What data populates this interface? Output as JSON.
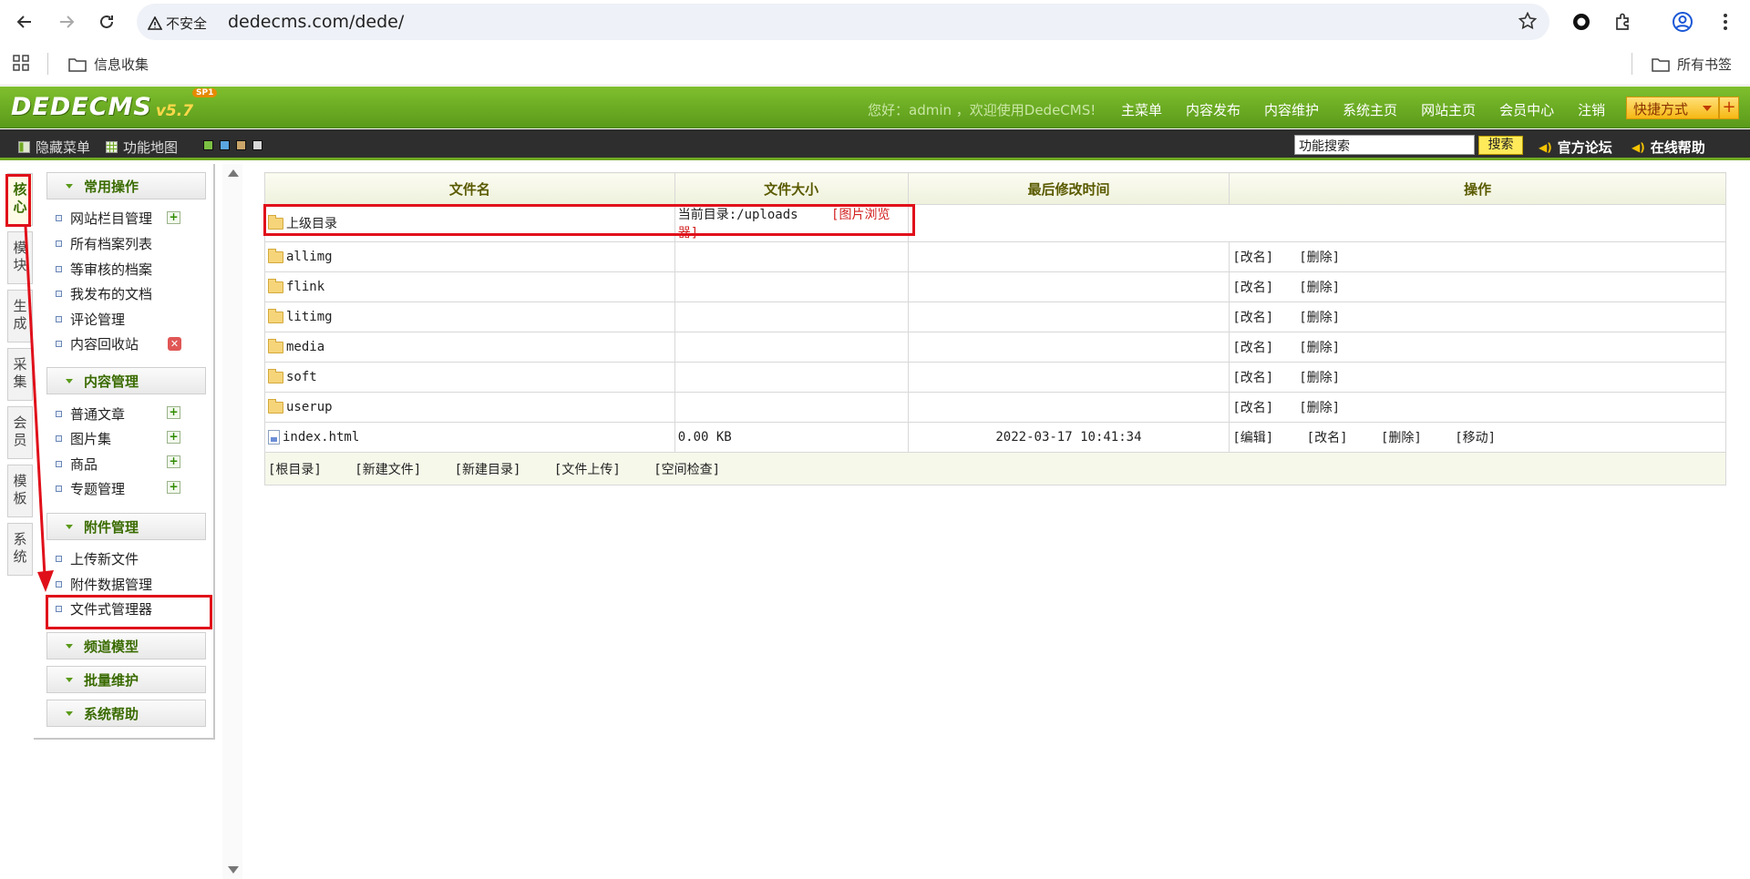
{
  "browser": {
    "security_label": "不安全",
    "url": "dedecms.com/dede/",
    "bookmark_folder": "信息收集",
    "all_bookmarks": "所有书签"
  },
  "header": {
    "logo_text": "DEDECMS",
    "logo_version": "v5.7",
    "logo_badge": "SP1",
    "welcome": "您好：admin ，欢迎使用DedeCMS!",
    "links": [
      "主菜单",
      "内容发布",
      "内容维护",
      "系统主页",
      "网站主页",
      "会员中心",
      "注销"
    ],
    "quick_label": "快捷方式",
    "quick_plus": "+"
  },
  "toolbar": {
    "hide_menu": "隐藏菜单",
    "feature_map": "功能地图",
    "search_value": "功能搜索",
    "search_button": "搜索",
    "forum": "官方论坛",
    "help": "在线帮助"
  },
  "vtabs": [
    "核心",
    "模块",
    "生成",
    "采集",
    "会员",
    "模板",
    "系统"
  ],
  "sidebar": {
    "section_common": "常用操作",
    "common_items": [
      "网站栏目管理",
      "所有档案列表",
      "等审核的档案",
      "我发布的文档",
      "评论管理",
      "内容回收站"
    ],
    "section_content": "内容管理",
    "content_items": [
      "普通文章",
      "图片集",
      "商品",
      "专题管理"
    ],
    "section_attach": "附件管理",
    "attach_items": [
      "上传新文件",
      "附件数据管理",
      "文件式管理器"
    ],
    "section_channel": "频道模型",
    "section_batch": "批量维护",
    "section_syshelp": "系统帮助"
  },
  "table": {
    "headers": [
      "文件名",
      "文件大小",
      "最后修改时间",
      "操作"
    ],
    "parent_dir": "上级目录",
    "current_dir": "当前目录:/uploads",
    "image_browser": "[图片浏览器]",
    "rows": [
      {
        "name": "allimg",
        "size": "",
        "mtime": "",
        "actions": [
          "[改名]",
          "[删除]"
        ]
      },
      {
        "name": "flink",
        "size": "",
        "mtime": "",
        "actions": [
          "[改名]",
          "[删除]"
        ]
      },
      {
        "name": "litimg",
        "size": "",
        "mtime": "",
        "actions": [
          "[改名]",
          "[删除]"
        ]
      },
      {
        "name": "media",
        "size": "",
        "mtime": "",
        "actions": [
          "[改名]",
          "[删除]"
        ]
      },
      {
        "name": "soft",
        "size": "",
        "mtime": "",
        "actions": [
          "[改名]",
          "[删除]"
        ]
      },
      {
        "name": "userup",
        "size": "",
        "mtime": "",
        "actions": [
          "[改名]",
          "[删除]"
        ]
      }
    ],
    "file_row": {
      "name": "index.html",
      "size": "0.00 KB",
      "mtime": "2022-03-17 10:41:34",
      "actions": [
        "[编辑]",
        "[改名]",
        "[删除]",
        "[移动]"
      ]
    },
    "footer_actions": [
      "[根目录]",
      "[新建文件]",
      "[新建目录]",
      "[文件上传]",
      "[空间检查]"
    ]
  },
  "colors": {
    "header_green": "#6fae24",
    "annotation_red": "#e0101a",
    "accent_gold": "#f6b813"
  }
}
